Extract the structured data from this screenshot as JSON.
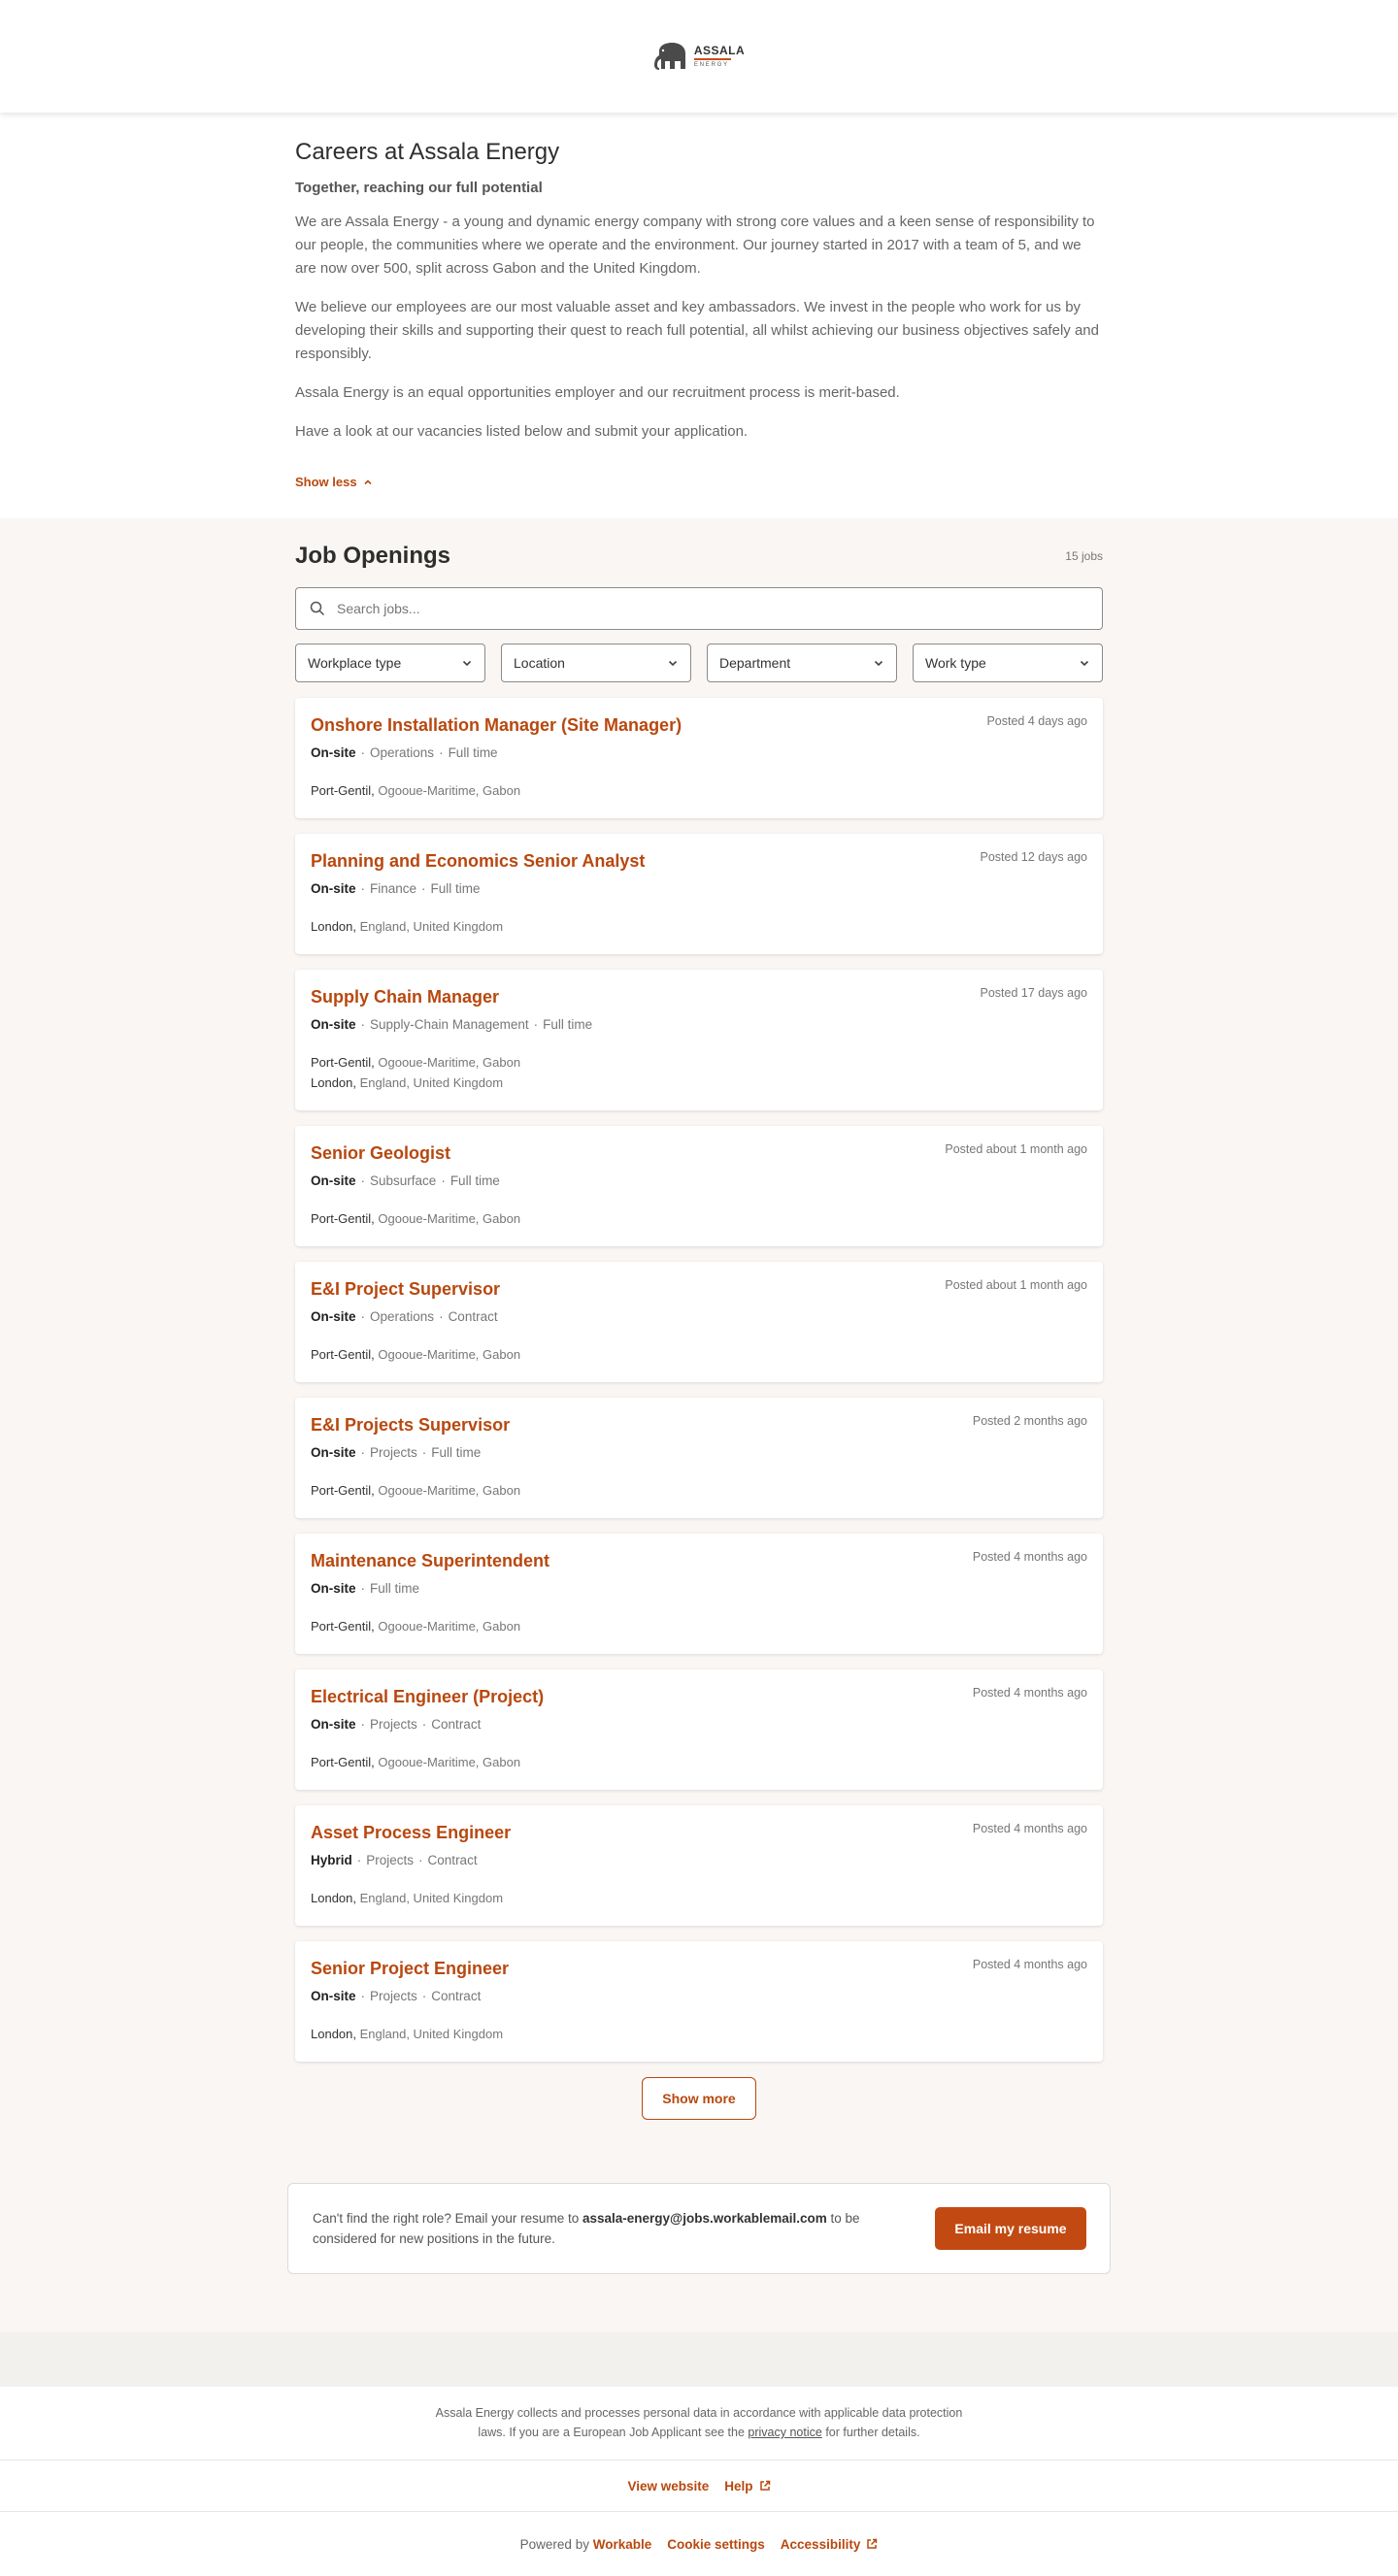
{
  "brand": {
    "name": "ASSALA",
    "sub": "ENERGY",
    "accent": "#b8480f",
    "button_color": "#c24a12"
  },
  "about": {
    "title": "Careers at Assala Energy",
    "tagline": "Together, reaching our full potential",
    "paragraphs": [
      "We are Assala Energy - a young and dynamic energy company with strong core values and a keen sense of responsibility to our people, the communities where we operate and the environment. Our journey started in 2017 with a team of 5, and we are now over 500, split across Gabon and the United Kingdom.",
      "We believe our employees are our most valuable asset and key ambassadors. We invest in the people who work for us by developing their skills and supporting their quest to reach full potential, all whilst achieving our business objectives safely and responsibly.",
      "Assala Energy is an equal opportunities employer and our recruitment process is merit-based.",
      "Have a look at our vacancies listed below and submit your application."
    ],
    "show_less": "Show less"
  },
  "openings": {
    "title": "Job Openings",
    "count": "15 jobs",
    "search_placeholder": "Search jobs...",
    "filters": [
      "Workplace type",
      "Location",
      "Department",
      "Work type"
    ],
    "jobs": [
      {
        "title": "Onshore Installation Manager (Site Manager)",
        "posted": "Posted 4 days ago",
        "workplace": "On-site",
        "details": [
          "Operations",
          "Full time"
        ],
        "locations": [
          {
            "city": "Port-Gentil,",
            "region": "Ogooue-Maritime, Gabon"
          }
        ]
      },
      {
        "title": "Planning and Economics Senior Analyst",
        "posted": "Posted 12 days ago",
        "workplace": "On-site",
        "details": [
          "Finance",
          "Full time"
        ],
        "locations": [
          {
            "city": "London,",
            "region": "England, United Kingdom"
          }
        ]
      },
      {
        "title": "Supply Chain Manager",
        "posted": "Posted 17 days ago",
        "workplace": "On-site",
        "details": [
          "Supply-Chain Management",
          "Full time"
        ],
        "locations": [
          {
            "city": "Port-Gentil,",
            "region": "Ogooue-Maritime, Gabon"
          },
          {
            "city": "London,",
            "region": "England, United Kingdom"
          }
        ]
      },
      {
        "title": "Senior Geologist",
        "posted": "Posted about 1 month ago",
        "workplace": "On-site",
        "details": [
          "Subsurface",
          "Full time"
        ],
        "locations": [
          {
            "city": "Port-Gentil,",
            "region": "Ogooue-Maritime, Gabon"
          }
        ]
      },
      {
        "title": "E&I Project Supervisor",
        "posted": "Posted about 1 month ago",
        "workplace": "On-site",
        "details": [
          "Operations",
          "Contract"
        ],
        "locations": [
          {
            "city": "Port-Gentil,",
            "region": "Ogooue-Maritime, Gabon"
          }
        ]
      },
      {
        "title": "E&I Projects Supervisor",
        "posted": "Posted 2 months ago",
        "workplace": "On-site",
        "details": [
          "Projects",
          "Full time"
        ],
        "locations": [
          {
            "city": "Port-Gentil,",
            "region": "Ogooue-Maritime, Gabon"
          }
        ]
      },
      {
        "title": "Maintenance Superintendent",
        "posted": "Posted 4 months ago",
        "workplace": "On-site",
        "details": [
          "Full time"
        ],
        "locations": [
          {
            "city": "Port-Gentil,",
            "region": "Ogooue-Maritime, Gabon"
          }
        ]
      },
      {
        "title": "Electrical Engineer (Project)",
        "posted": "Posted 4 months ago",
        "workplace": "On-site",
        "details": [
          "Projects",
          "Contract"
        ],
        "locations": [
          {
            "city": "Port-Gentil,",
            "region": "Ogooue-Maritime, Gabon"
          }
        ]
      },
      {
        "title": "Asset Process Engineer",
        "posted": "Posted 4 months ago",
        "workplace": "Hybrid",
        "details": [
          "Projects",
          "Contract"
        ],
        "locations": [
          {
            "city": "London,",
            "region": "England, United Kingdom"
          }
        ]
      },
      {
        "title": "Senior Project Engineer",
        "posted": "Posted 4 months ago",
        "workplace": "On-site",
        "details": [
          "Projects",
          "Contract"
        ],
        "locations": [
          {
            "city": "London,",
            "region": "England, United Kingdom"
          }
        ]
      }
    ],
    "show_more": "Show more"
  },
  "resume": {
    "text_before": "Can't find the right role? Email your resume to",
    "email": "assala-energy@jobs.workablemail.com",
    "text_after": "to be considered for new positions in the future.",
    "button": "Email my resume"
  },
  "footer": {
    "privacy_before": "Assala Energy collects and processes personal data in accordance with applicable data protection laws. If you are a European Job Applicant see the",
    "privacy_link": "privacy notice",
    "privacy_after": "for further details.",
    "view_website": "View website",
    "help": "Help",
    "powered_by": "Powered by",
    "workable": "Workable",
    "cookie_settings": "Cookie settings",
    "accessibility": "Accessibility"
  }
}
